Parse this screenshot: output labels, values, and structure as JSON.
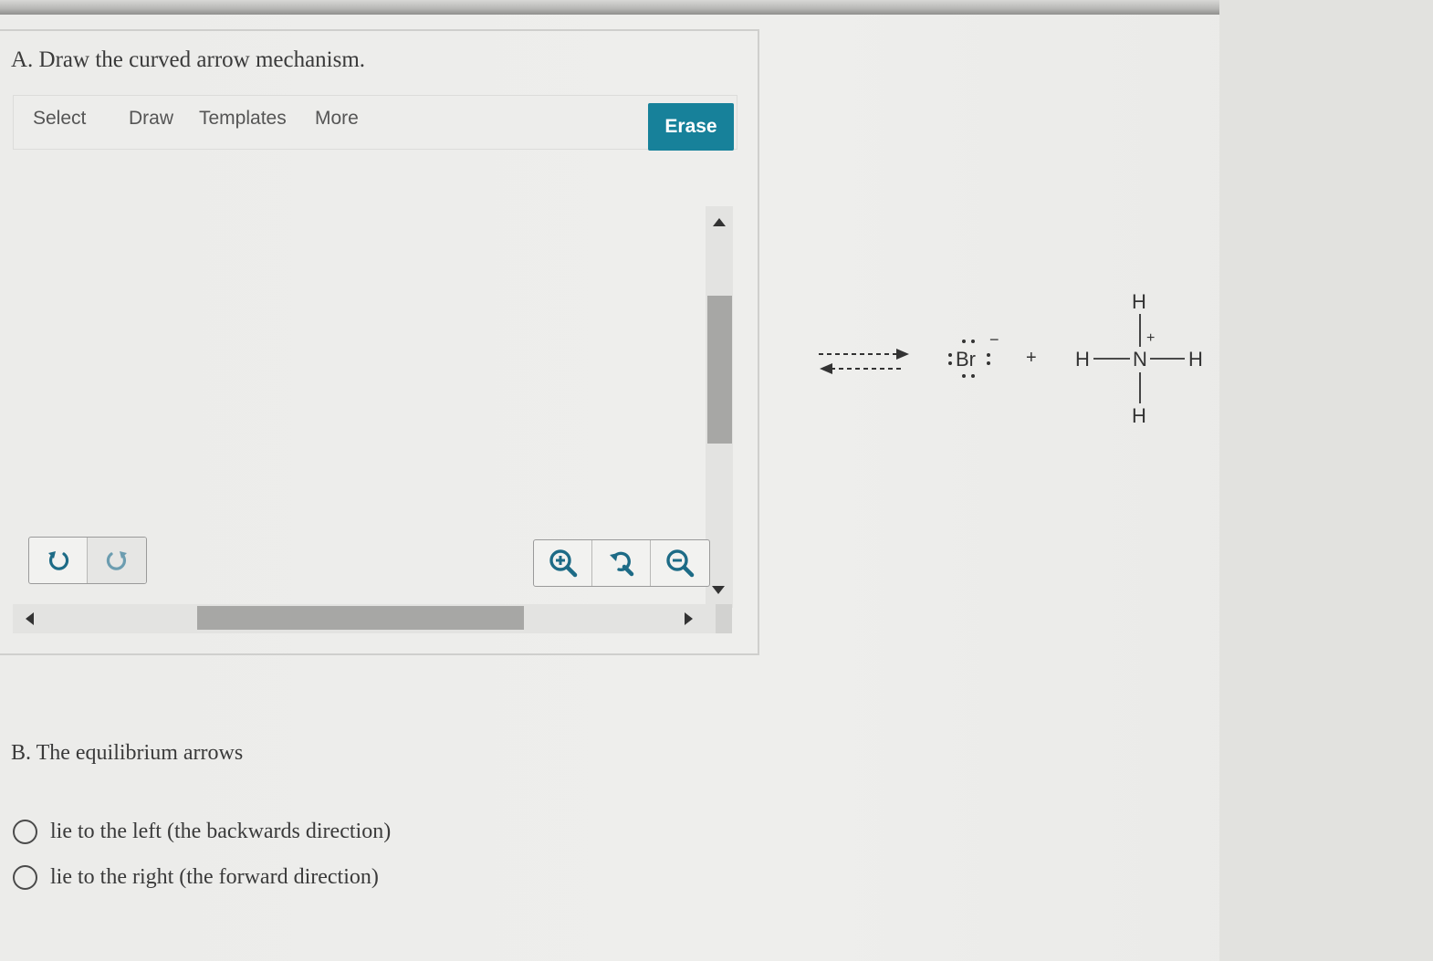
{
  "part_a": {
    "title": "A. Draw the curved arrow mechanism.",
    "toolbar": {
      "items": [
        "Select",
        "Draw",
        "Templates",
        "More"
      ],
      "erase_label": "Erase"
    },
    "undo_redo_icons": [
      "undo-icon",
      "redo-icon"
    ],
    "zoom_icons": [
      "zoom-in-icon",
      "reset-zoom-icon",
      "zoom-out-icon"
    ]
  },
  "reaction": {
    "bromide": "Br",
    "bromide_charge": "−",
    "plus": "+",
    "ammonium": {
      "central_atom": "N",
      "charge": "+",
      "h_top": "H",
      "h_left": "H",
      "h_right": "H",
      "h_bottom": "H"
    }
  },
  "part_b": {
    "title": "B. The equilibrium arrows",
    "options": [
      "lie to the left (the backwards direction)",
      "lie to the right (the forward direction)"
    ]
  },
  "colors": {
    "erase_button": "#17819a",
    "text": "#3a3a3a"
  }
}
